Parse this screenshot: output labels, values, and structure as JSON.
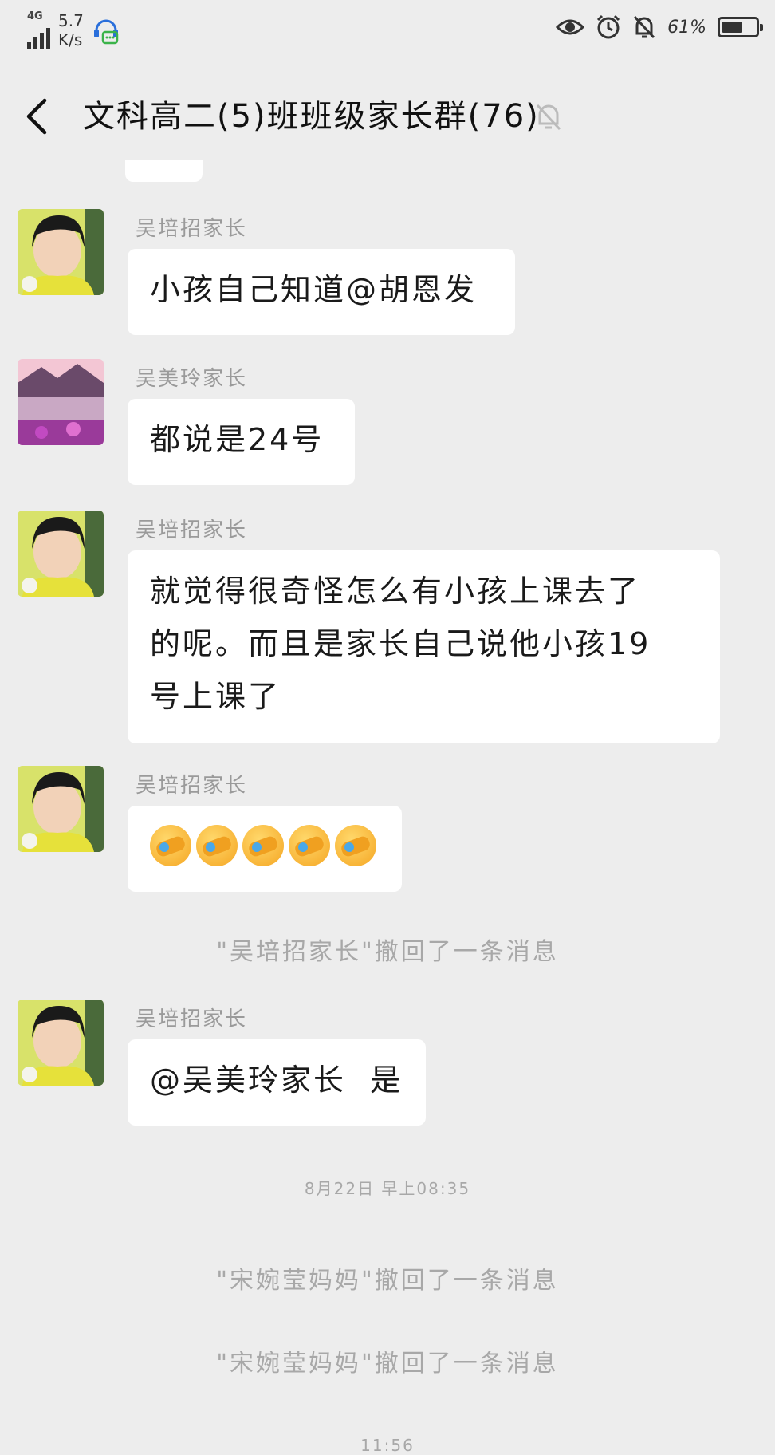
{
  "status_bar": {
    "network": "4G",
    "speed_value": "5.7",
    "speed_unit": "K/s",
    "battery_percent": "61%",
    "battery_level": 0.61
  },
  "header": {
    "title": "文科高二(5)班班级家长群(76)"
  },
  "messages": [
    {
      "sender": "吴培招家长",
      "text": "小孩自己知道@胡恩发"
    },
    {
      "sender": "吴美玲家长",
      "text": "都说是24号"
    },
    {
      "sender": "吴培招家长",
      "lines": [
        "就觉得很奇怪怎么有小孩上课去了",
        "的呢。而且是家长自己说他小孩19",
        "号上课了"
      ]
    },
    {
      "sender": "吴培招家长",
      "emoji_count": 5,
      "emoji_name": "crying-laughing-emoji"
    },
    {
      "sender": "吴培招家长",
      "text": "@吴美玲家长  是"
    }
  ],
  "system": {
    "recall_1": "\"吴培招家长\"撤回了一条消息",
    "timestamp_1": "8月22日 早上08:35",
    "recall_2": "\"宋婉莹妈妈\"撤回了一条消息",
    "recall_3": "\"宋婉莹妈妈\"撤回了一条消息",
    "timestamp_2": "11:56"
  }
}
